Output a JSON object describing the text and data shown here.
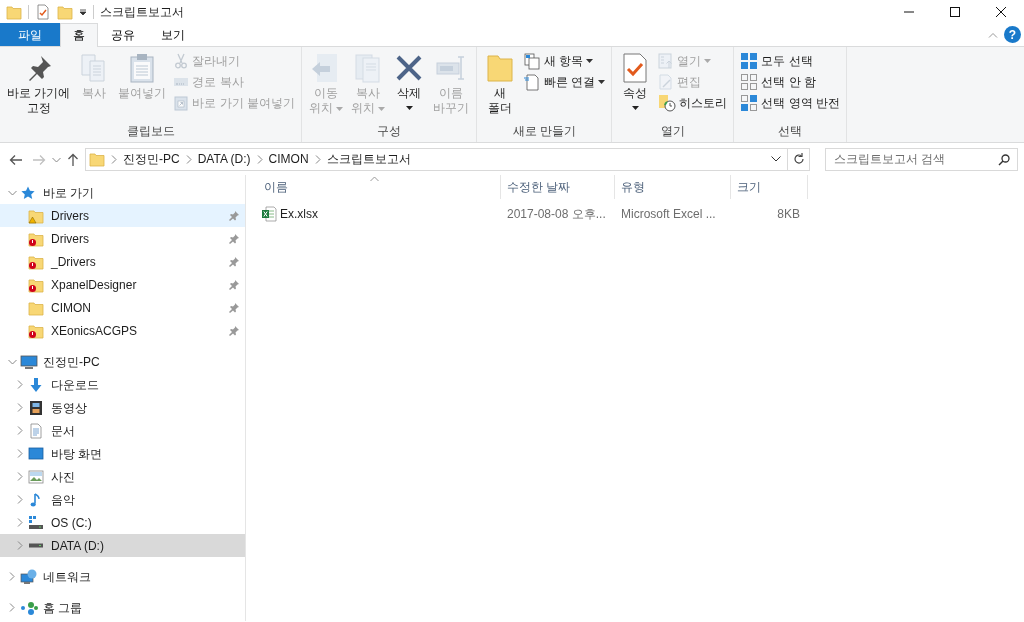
{
  "window": {
    "title": "스크립트보고서"
  },
  "ribbon_tabs": [
    {
      "label": "파일",
      "kind": "file",
      "selected": false
    },
    {
      "label": "홈",
      "kind": "tab",
      "selected": true
    },
    {
      "label": "공유",
      "kind": "tab",
      "selected": false
    },
    {
      "label": "보기",
      "kind": "tab",
      "selected": false
    }
  ],
  "help_label": "?",
  "ribbon_groups": [
    {
      "label": "클립보드",
      "items": [
        {
          "kind": "large",
          "lines": [
            "바로 가기에",
            "고정"
          ],
          "disabled": false,
          "dropdown": false
        },
        {
          "kind": "large",
          "lines": [
            "복사"
          ],
          "disabled": true,
          "dropdown": false
        },
        {
          "kind": "large",
          "lines": [
            "붙여넣기"
          ],
          "disabled": true,
          "dropdown": false
        },
        {
          "kind": "stack",
          "items": [
            {
              "label": "잘라내기",
              "disabled": true,
              "dropdown": false
            },
            {
              "label": "경로 복사",
              "disabled": true,
              "dropdown": false
            },
            {
              "label": "바로 가기 붙여넣기",
              "disabled": true,
              "dropdown": false
            }
          ]
        }
      ]
    },
    {
      "label": "구성",
      "items": [
        {
          "kind": "large",
          "lines": [
            "이동",
            "위치"
          ],
          "disabled": true,
          "dropdown": true
        },
        {
          "kind": "large",
          "lines": [
            "복사",
            "위치"
          ],
          "disabled": true,
          "dropdown": true
        },
        {
          "kind": "large",
          "lines": [
            "삭제"
          ],
          "disabled": false,
          "dropdown": true
        },
        {
          "kind": "large",
          "lines": [
            "이름",
            "바꾸기"
          ],
          "disabled": true,
          "dropdown": false
        }
      ]
    },
    {
      "label": "새로 만들기",
      "items": [
        {
          "kind": "large",
          "lines": [
            "새",
            "폴더"
          ],
          "disabled": false,
          "dropdown": false
        },
        {
          "kind": "stack",
          "items": [
            {
              "label": "새 항목",
              "disabled": false,
              "dropdown": true
            },
            {
              "label": "빠른 연결",
              "disabled": false,
              "dropdown": true
            }
          ]
        }
      ]
    },
    {
      "label": "열기",
      "items": [
        {
          "kind": "large",
          "lines": [
            "속성"
          ],
          "disabled": false,
          "dropdown": true
        },
        {
          "kind": "stack",
          "items": [
            {
              "label": "열기",
              "disabled": true,
              "dropdown": true
            },
            {
              "label": "편집",
              "disabled": true,
              "dropdown": false
            },
            {
              "label": "히스토리",
              "disabled": false,
              "dropdown": false
            }
          ]
        }
      ]
    },
    {
      "label": "선택",
      "items": [
        {
          "kind": "stack",
          "items": [
            {
              "label": "모두 선택",
              "disabled": false,
              "dropdown": false
            },
            {
              "label": "선택 안 함",
              "disabled": false,
              "dropdown": false
            },
            {
              "label": "선택 영역 반전",
              "disabled": false,
              "dropdown": false
            }
          ]
        }
      ]
    }
  ],
  "navigation": {
    "forward_disabled": true,
    "path": [
      "진정민-PC",
      "DATA (D:)",
      "CIMON",
      "스크립트보고서"
    ],
    "search": {
      "placeholder": "스크립트보고서 검색"
    }
  },
  "sidebar": [
    {
      "label": "바로 가기",
      "expanded": true,
      "children": [
        {
          "label": "Drivers",
          "pinned": true,
          "selected": false,
          "hot": true
        },
        {
          "label": "Drivers",
          "pinned": true,
          "selected": false,
          "hot": false
        },
        {
          "label": "_Drivers",
          "pinned": true,
          "selected": false,
          "hot": false
        },
        {
          "label": "XpanelDesigner",
          "pinned": true,
          "selected": false,
          "hot": false
        },
        {
          "label": "CIMON",
          "pinned": true,
          "selected": false,
          "hot": false
        },
        {
          "label": "XEonicsACGPS",
          "pinned": true,
          "selected": false,
          "hot": false
        }
      ]
    },
    {
      "label": "진정민-PC",
      "expanded": true,
      "children": [
        {
          "label": "다운로드",
          "expanded": false,
          "selected": false,
          "hot": false
        },
        {
          "label": "동영상",
          "expanded": false,
          "selected": false,
          "hot": false
        },
        {
          "label": "문서",
          "expanded": false,
          "selected": false,
          "hot": false
        },
        {
          "label": "바탕 화면",
          "expanded": false,
          "selected": false,
          "hot": false
        },
        {
          "label": "사진",
          "expanded": false,
          "selected": false,
          "hot": false
        },
        {
          "label": "음악",
          "expanded": false,
          "selected": false,
          "hot": false
        },
        {
          "label": "OS (C:)",
          "expanded": false,
          "selected": false,
          "hot": false
        },
        {
          "label": "DATA (D:)",
          "expanded": false,
          "selected": true,
          "hot": false
        }
      ]
    },
    {
      "label": "네트워크",
      "expanded": false
    },
    {
      "label": "홈 그룹",
      "expanded": false
    }
  ],
  "columns": [
    {
      "label": "이름",
      "sorted": true
    },
    {
      "label": "수정한 날짜",
      "sorted": false
    },
    {
      "label": "유형",
      "sorted": false
    },
    {
      "label": "크기",
      "sorted": false
    }
  ],
  "files": [
    {
      "name": "Ex.xlsx",
      "modified": "2017-08-08 오후...",
      "type": "Microsoft Excel ...",
      "size": "8KB"
    }
  ]
}
